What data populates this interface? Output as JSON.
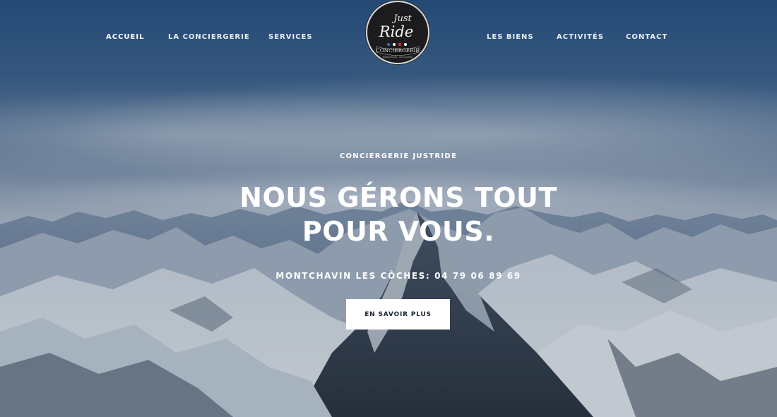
{
  "nav": {
    "left": [
      {
        "label": "ACCUEIL",
        "active": true
      },
      {
        "label": "LA CONCIERGERIE",
        "active": false
      },
      {
        "label": "SERVICES",
        "active": false
      }
    ],
    "right": [
      {
        "label": "LES BIENS",
        "active": false
      },
      {
        "label": "ACTIVITÉS",
        "active": false
      },
      {
        "label": "CONTACT",
        "active": false
      }
    ]
  },
  "logo": {
    "line1": "Just",
    "line2": "Ride",
    "banner": "CONCIERGERIE",
    "tagline": "MONTCHAVIN · LES CÔCHES",
    "star_colors": [
      "#2f6fd1",
      "#ffffff",
      "#e0312c",
      "#ffffff"
    ]
  },
  "hero": {
    "kicker": "CONCIERGERIE JUSTRIDE",
    "headline_line1": "NOUS GÉRONS TOUT",
    "headline_line2": "POUR VOUS.",
    "phone": "MONTCHAVIN LES CÔCHES: 04 79 06 89 69",
    "cta_label": "EN SAVOIR PLUS"
  }
}
